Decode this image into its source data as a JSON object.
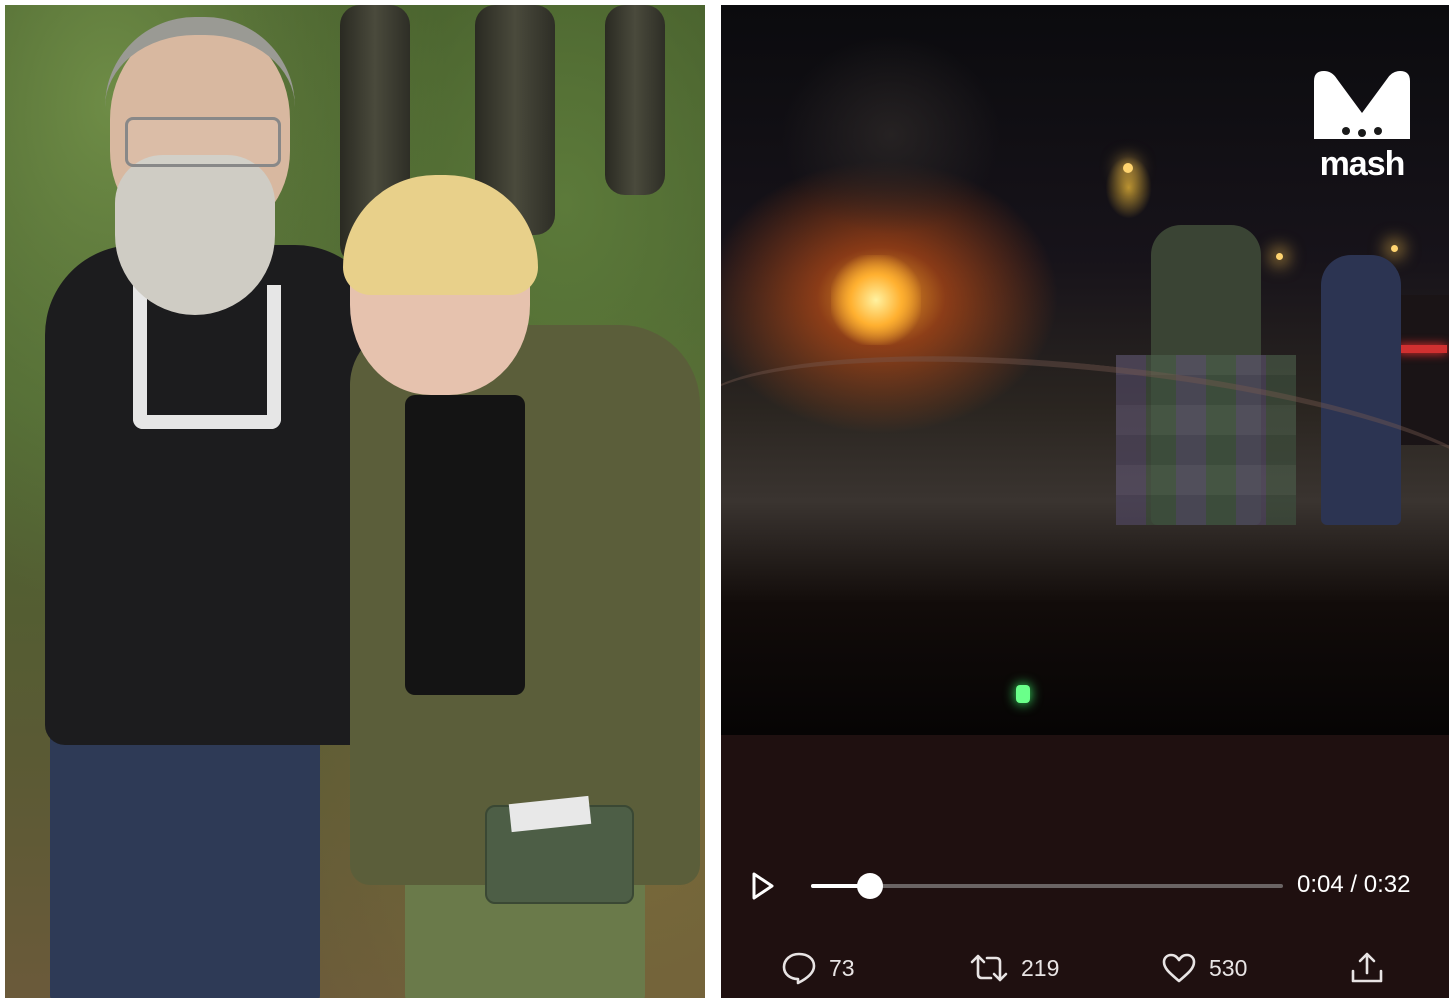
{
  "brand": {
    "name": "mash",
    "color": "#ffffff"
  },
  "player": {
    "current_time": "0:04",
    "separator": "/",
    "duration": "0:32",
    "progress_fraction": 0.125,
    "play_icon": "play-icon"
  },
  "actions": {
    "replies": {
      "icon": "reply-icon",
      "count": "73"
    },
    "retweets": {
      "icon": "retweet-icon",
      "count": "219"
    },
    "likes": {
      "icon": "heart-icon",
      "count": "530"
    },
    "share": {
      "icon": "share-icon"
    }
  },
  "colors": {
    "player_background": "#1f1010",
    "control_text": "#ffffff",
    "track": "#6a6464"
  }
}
